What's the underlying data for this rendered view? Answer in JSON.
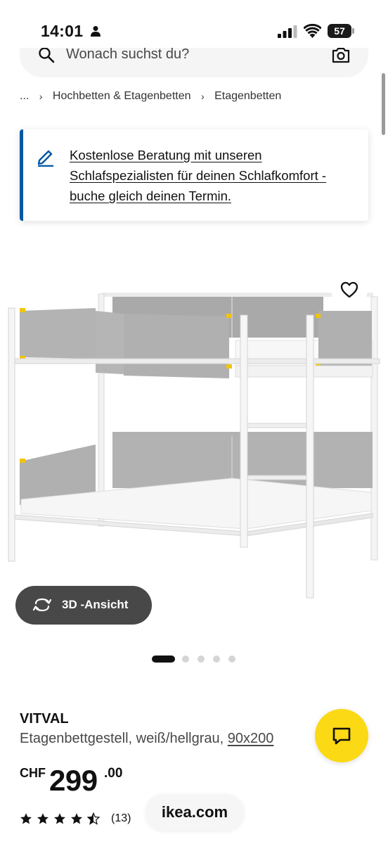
{
  "status_bar": {
    "time": "14:01",
    "battery": "57",
    "icons": [
      "person-icon",
      "signal-icon",
      "wifi-icon",
      "battery-icon"
    ]
  },
  "search": {
    "placeholder": "Wonach suchst du?",
    "icons": [
      "search-icon",
      "camera-icon"
    ]
  },
  "breadcrumb": {
    "ellipsis": "...",
    "items": [
      "Hochbetten & Etagenbetten",
      "Etagenbetten"
    ]
  },
  "info_banner": {
    "text": "Kostenlose Beratung mit unseren Schlafspezialisten für deinen Schlafkomfort - buche gleich deinen Termin.",
    "icon": "pencil-icon",
    "accent_color": "#0058a3"
  },
  "gallery": {
    "view3d_label": "3D -Ansicht",
    "image_count": 5,
    "active_index": 0,
    "wishlist_icon": "heart-icon"
  },
  "product": {
    "name": "VITVAL",
    "description": "Etagenbettgestell, weiß/hellgrau,",
    "size": "90x200",
    "price_currency": "CHF",
    "price_main": "299",
    "price_cents": ".00",
    "rating": 4.5,
    "rating_max": 5,
    "review_count": "(13)"
  },
  "browser": {
    "domain": "ikea.com"
  },
  "chat": {
    "icon": "chat-icon",
    "color": "#fbd914"
  }
}
